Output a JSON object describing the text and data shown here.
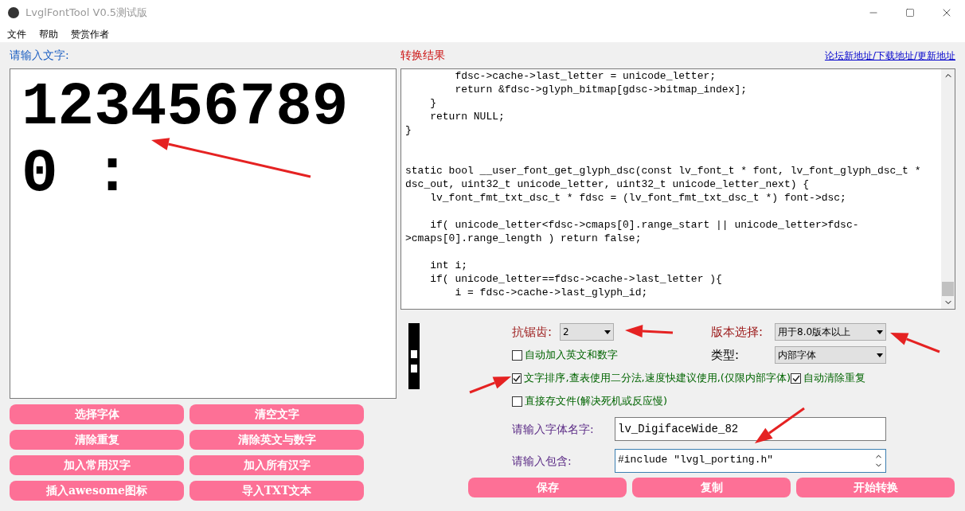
{
  "window": {
    "title": "LvglFontTool V0.5测试版"
  },
  "menu": [
    "文件",
    "帮助",
    "赞赏作者"
  ],
  "input_panel": {
    "label": "请输入文字:",
    "text_lines": [
      "123456789",
      "0 :"
    ]
  },
  "left_buttons": [
    "选择字体",
    "清空文字",
    "清除重复",
    "清除英文与数字",
    "加入常用汉字",
    "加入所有汉字",
    "插入awesome图标",
    "导入TXT文本"
  ],
  "output_panel": {
    "label": "转换结果",
    "link": "论坛新地址/下载地址/更新地址",
    "code_lines": [
      {
        "kind": "line",
        "text": "        fdsc->cache->last_letter = unicode_letter;"
      },
      {
        "kind": "line",
        "text": "        return &fdsc->glyph_bitmap[gdsc->bitmap_index];"
      },
      {
        "kind": "line",
        "text": "    }"
      },
      {
        "kind": "line",
        "text": "    return NULL;"
      },
      {
        "kind": "line",
        "text": "}"
      },
      {
        "kind": "blank"
      },
      {
        "kind": "blank"
      },
      {
        "kind": "line",
        "text": "static bool __user_font_get_glyph_dsc(const lv_font_t * font, lv_font_glyph_dsc_t *"
      },
      {
        "kind": "line",
        "text": "dsc_out, uint32_t unicode_letter, uint32_t unicode_letter_next) {"
      },
      {
        "kind": "line",
        "text": "    lv_font_fmt_txt_dsc_t * fdsc = (lv_font_fmt_txt_dsc_t *) font->dsc;"
      },
      {
        "kind": "blank"
      },
      {
        "kind": "line",
        "text": "    if( unicode_letter<fdsc->cmaps[0].range_start || unicode_letter>fdsc-"
      },
      {
        "kind": "line",
        "text": ">cmaps[0].range_length ) return false;"
      },
      {
        "kind": "blank"
      },
      {
        "kind": "line",
        "text": "    int i;"
      },
      {
        "kind": "line",
        "text": "    if( unicode_letter==fdsc->cache->last_letter ){"
      },
      {
        "kind": "line",
        "text": "        i = fdsc->cache->last_glyph_id;"
      }
    ]
  },
  "options": {
    "antialias": {
      "label": "抗锯齿:",
      "value": "2"
    },
    "version": {
      "label": "版本选择:",
      "value": "用于8.0版本以上"
    },
    "type": {
      "label": "类型:",
      "value": "内部字体"
    },
    "checkboxes": [
      {
        "label": "自动加入英文和数字",
        "checked": false
      },
      {
        "label": "文字排序,查表使用二分法,速度快建议使用,(仅限内部字体)",
        "checked": true
      },
      {
        "label": "自动清除重复",
        "checked": true
      },
      {
        "label": "直接存文件(解决死机或反应慢)",
        "checked": false
      }
    ]
  },
  "font_name": {
    "label": "请输入字体名字:",
    "value": "lv_DigifaceWide_82"
  },
  "include": {
    "label": "请输入包含:",
    "value": "#include \"lvgl_porting.h\""
  },
  "bottom_buttons": [
    "保存",
    "复制",
    "开始转换"
  ]
}
